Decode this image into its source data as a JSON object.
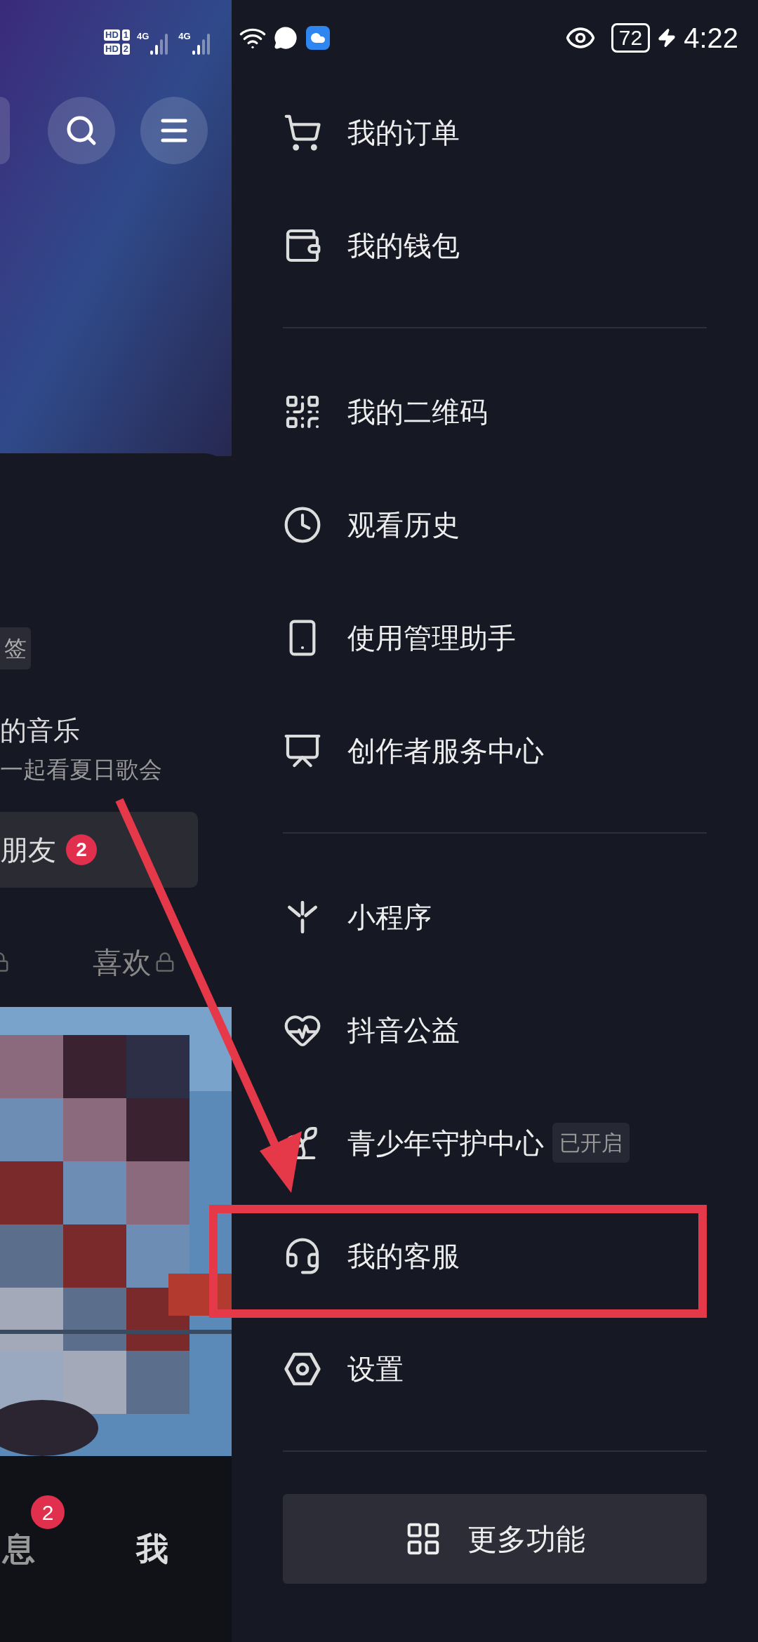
{
  "status_bar": {
    "sim_labels": [
      "HD",
      "1",
      "HD",
      "2"
    ],
    "network": [
      "4G",
      "4G"
    ],
    "battery": "72",
    "time": "4:22"
  },
  "background_profile": {
    "tag": "签",
    "music_title": "的音乐",
    "music_subtitle": "一起看夏日歌会",
    "friends_button": {
      "label": "朋友",
      "badge": "2"
    },
    "tab": "喜欢",
    "bottom_nav": [
      {
        "label": "息",
        "badge": "2"
      },
      {
        "label": "我"
      }
    ]
  },
  "drawer": {
    "groups": [
      [
        {
          "label": "我的订单",
          "highlighted": false
        },
        {
          "label": "我的钱包",
          "highlighted": false
        }
      ],
      [
        {
          "label": "我的二维码",
          "highlighted": false
        },
        {
          "label": "观看历史",
          "highlighted": false
        },
        {
          "label": "使用管理助手",
          "highlighted": false
        },
        {
          "label": "创作者服务中心",
          "highlighted": false
        }
      ],
      [
        {
          "label": "小程序",
          "highlighted": false
        },
        {
          "label": "抖音公益",
          "highlighted": false
        },
        {
          "label": "青少年守护中心",
          "tag": "已开启",
          "highlighted": false
        },
        {
          "label": "我的客服",
          "highlighted": true
        },
        {
          "label": "设置",
          "highlighted": false
        }
      ]
    ],
    "more_button": "更多功能"
  }
}
